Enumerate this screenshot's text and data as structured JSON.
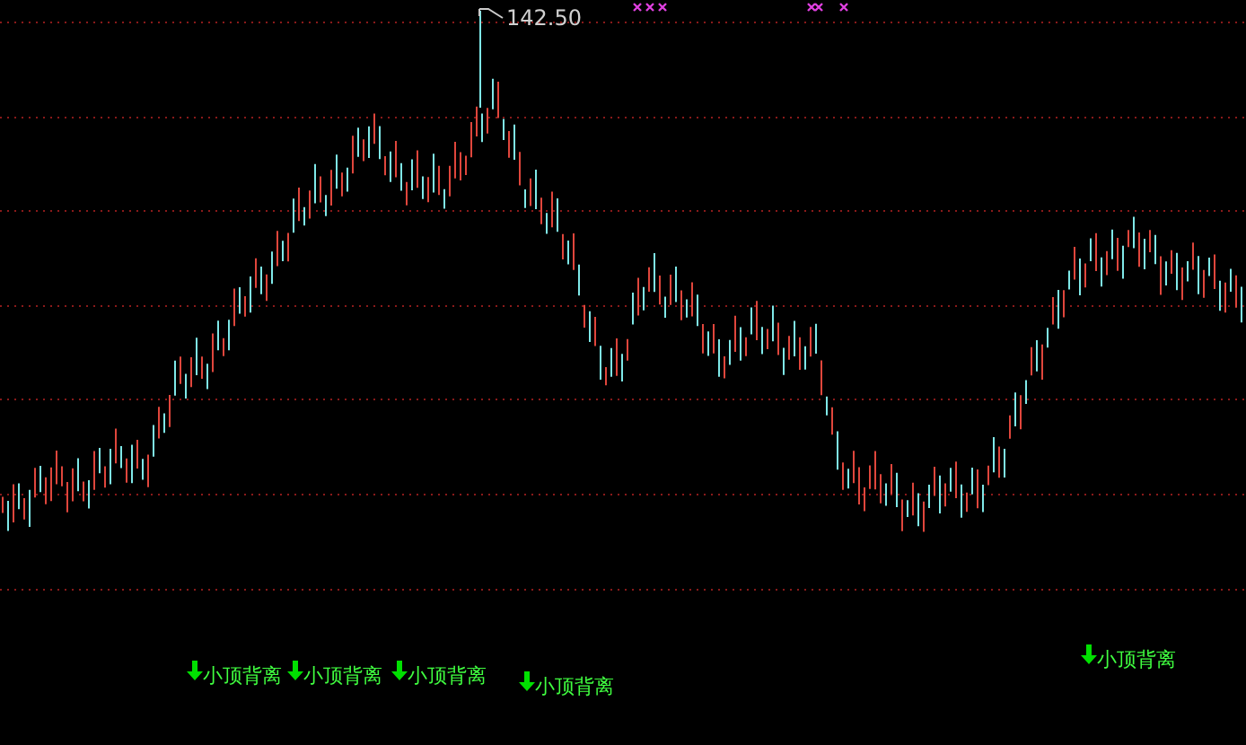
{
  "price_label": {
    "text": "142.50"
  },
  "signals": [
    {
      "text": "小顶背离"
    },
    {
      "text": "小顶背离"
    },
    {
      "text": "小顶背离"
    },
    {
      "text": "小顶背离"
    },
    {
      "text": "小顶背离"
    }
  ]
}
